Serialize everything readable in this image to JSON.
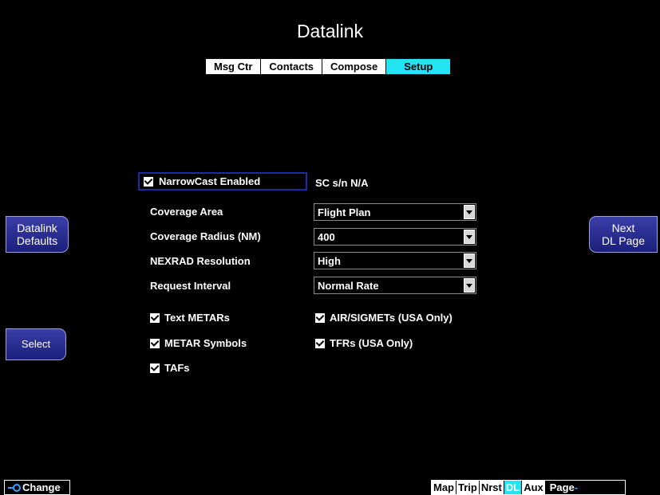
{
  "title": "Datalink",
  "tabs": [
    {
      "label": "Msg Ctr",
      "active": false
    },
    {
      "label": "Contacts",
      "active": false
    },
    {
      "label": "Compose",
      "active": false
    },
    {
      "label": "Setup",
      "active": true
    }
  ],
  "side_buttons": {
    "datalink_defaults": {
      "line1": "Datalink",
      "line2": "Defaults"
    },
    "select": "Select",
    "next_dl_page": {
      "line1": "Next",
      "line2": "DL Page"
    }
  },
  "narrowcast": {
    "label": "NarrowCast Enabled",
    "checked": true,
    "sc_sn": "SC s/n N/A"
  },
  "settings": [
    {
      "label": "Coverage Area",
      "value": "Flight Plan"
    },
    {
      "label": "Coverage Radius (NM)",
      "value": "400"
    },
    {
      "label": "NEXRAD Resolution",
      "value": "High"
    },
    {
      "label": "Request Interval",
      "value": "Normal Rate"
    }
  ],
  "checkboxes": {
    "text_metars": "Text METARs",
    "metar_symbols": "METAR Symbols",
    "tafs": "TAFs",
    "airsigmets": "AIR/SIGMETs (USA Only)",
    "tfrs": "TFRs (USA Only)"
  },
  "bottom": {
    "change": "Change",
    "pages": [
      {
        "label": "Map",
        "active": false
      },
      {
        "label": "Trip",
        "active": false
      },
      {
        "label": "Nrst",
        "active": false
      },
      {
        "label": "DL",
        "active": true
      },
      {
        "label": "Aux",
        "active": false
      }
    ],
    "page_label": "Page"
  },
  "colors": {
    "accent": "#22e4f2",
    "button": "#2a2e90",
    "focus": "#1c2aa8"
  }
}
